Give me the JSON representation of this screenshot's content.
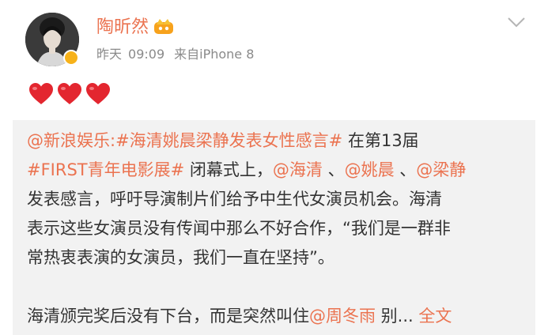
{
  "user": {
    "name": "陶昕然",
    "time_day": "昨天",
    "time": "09:09",
    "source_prefix": "来自",
    "source": "iPhone 8"
  },
  "icons": {
    "avatar": "avatar-portrait",
    "verified": "verified-badge-icon",
    "vip": "vip-crown-icon",
    "menu": "chevron-down-icon",
    "reaction": "heart-icon"
  },
  "emoji_hearts": 3,
  "repost": {
    "mention1": "@新浪娱乐",
    "colon": ":",
    "hashtag1": "#海清姚晨梁静发表女性感言#",
    "text1": " 在第13届",
    "hashtag2": "#FIRST青年电影展#",
    "text2": " 闭幕式上，",
    "mention2": "@海清",
    "sep1": " 、",
    "mention3": "@姚晨",
    "sep2": " 、",
    "mention4": "@梁静",
    "line3": "发表感言，呼吁导演制片们给予中生代女演员机会。海清",
    "line4": "表示这些女演员没有传闻中那么不好合作，“我们是一群非",
    "line5": "常热衷表演的女演员，我们一直在坚持”。",
    "line6_text": "海清颁完奖后没有下台，而是突然叫住",
    "mention5": "@周冬雨",
    "line6_tail": " 别...",
    "read_more": " 全文"
  },
  "colors": {
    "accent": "#eb7350",
    "meta": "#8a8a8a",
    "text": "#333333",
    "repost_bg": "#f2f2f2"
  }
}
